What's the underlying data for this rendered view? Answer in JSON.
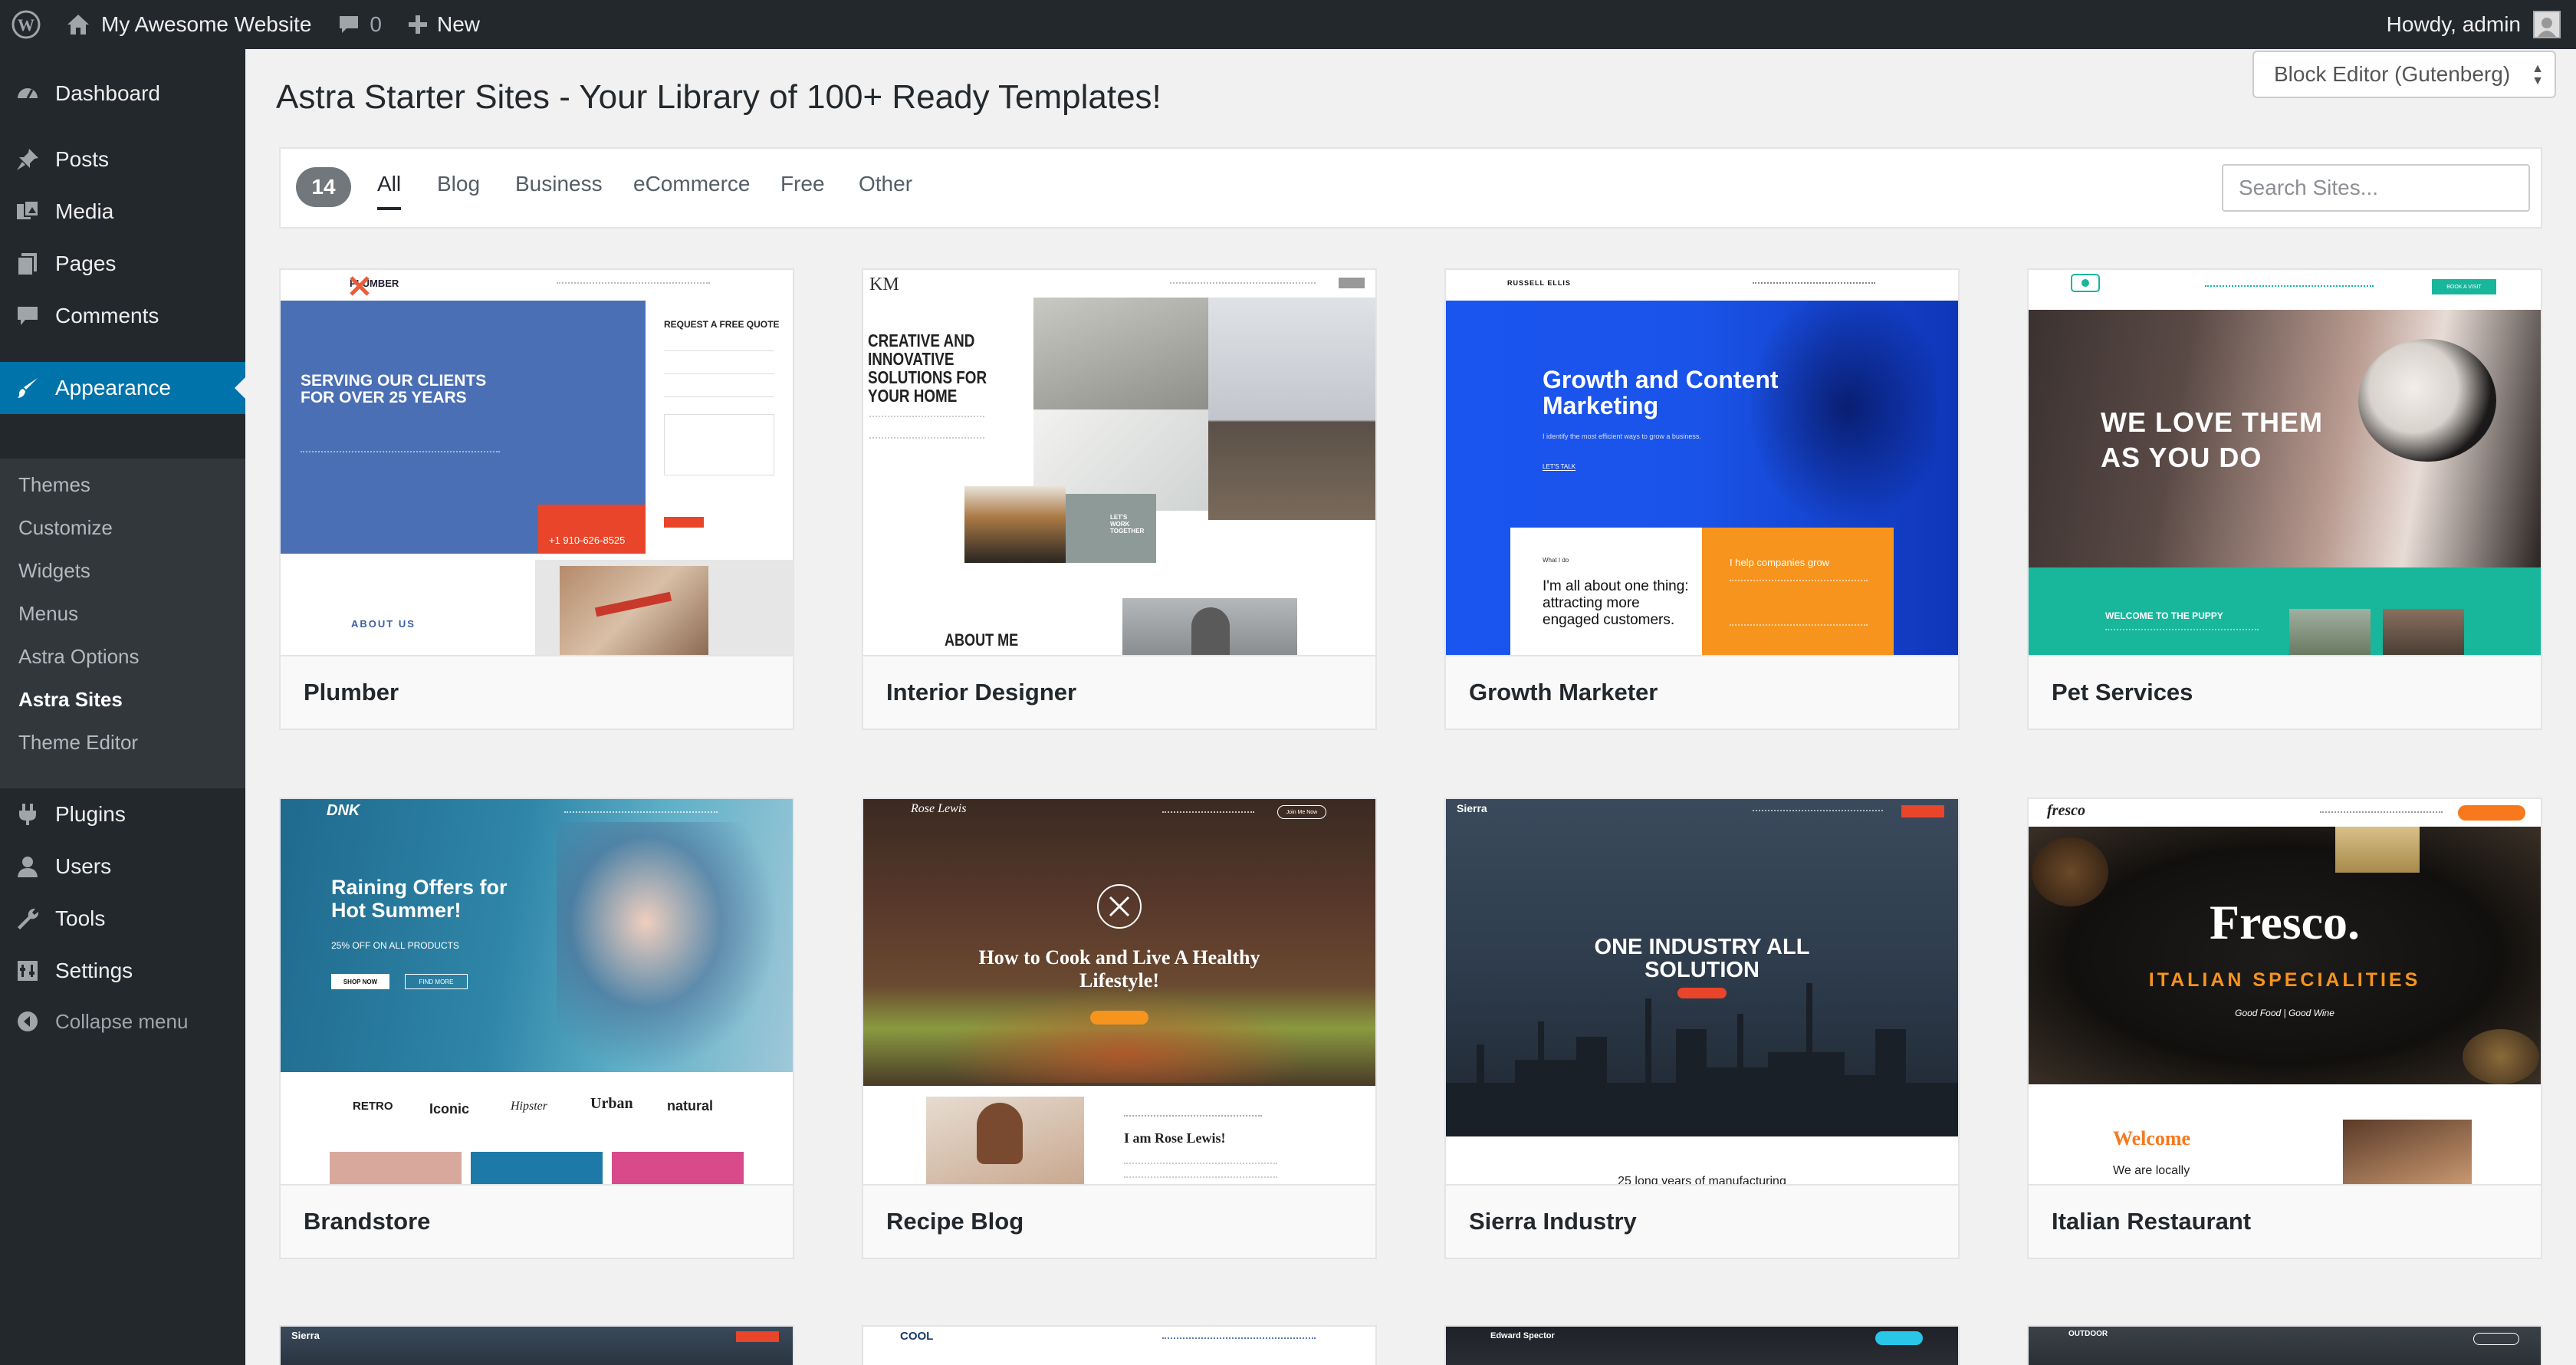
{
  "adminbar": {
    "site_name": "My Awesome Website",
    "comments_count": "0",
    "new_label": "New",
    "howdy": "Howdy, admin"
  },
  "sidebar": {
    "items": [
      {
        "label": "Dashboard",
        "icon": "dashboard-icon"
      },
      {
        "label": "Posts",
        "icon": "pin-icon"
      },
      {
        "label": "Media",
        "icon": "media-icon"
      },
      {
        "label": "Pages",
        "icon": "pages-icon"
      },
      {
        "label": "Comments",
        "icon": "comment-icon"
      },
      {
        "label": "Appearance",
        "icon": "paintbrush-icon",
        "active": true
      },
      {
        "label": "Plugins",
        "icon": "plug-icon"
      },
      {
        "label": "Users",
        "icon": "user-icon"
      },
      {
        "label": "Tools",
        "icon": "wrench-icon"
      },
      {
        "label": "Settings",
        "icon": "settings-icon"
      },
      {
        "label": "Collapse menu",
        "icon": "collapse-icon"
      }
    ],
    "submenu": [
      "Themes",
      "Customize",
      "Widgets",
      "Menus",
      "Astra Options",
      "Astra Sites",
      "Theme Editor"
    ],
    "current_submenu": "Astra Sites"
  },
  "main": {
    "title": "Astra Starter Sites - Your Library of 100+ Ready Templates!",
    "editor_select": "Block Editor (Gutenberg)",
    "filter": {
      "count": "14",
      "tabs": [
        "All",
        "Blog",
        "Business",
        "eCommerce",
        "Free",
        "Other"
      ],
      "active_tab": "All",
      "search_placeholder": "Search Sites..."
    },
    "cards": [
      {
        "name": "Plumber",
        "hero": "SERVING OUR CLIENTS FOR OVER 25 YEARS",
        "quote": "REQUEST A FREE QUOTE",
        "phone": "+1 910-626-8525",
        "about": "ABOUT US",
        "brand": "PLUMBER"
      },
      {
        "name": "Interior Designer",
        "hero": "CREATIVE AND INNOVATIVE SOLUTIONS FOR YOUR HOME",
        "about": "ABOUT ME",
        "brand": "KM",
        "cta": "LET'S WORK TOGETHER"
      },
      {
        "name": "Growth Marketer",
        "hero": "Growth and Content Marketing",
        "sub": "I identify the most efficient ways to grow a business.",
        "quote": "I'm all about one thing: attracting more engaged customers.",
        "help": "I help companies grow",
        "brand": "RUSSELL ELLIS",
        "cta": "LET'S TALK",
        "label": "What I do"
      },
      {
        "name": "Pet Services",
        "hero": "WE LOVE THEM AS YOU DO",
        "sub": "WELCOME TO THE PUPPY",
        "cta": "BOOK A VISIT"
      },
      {
        "name": "Brandstore",
        "hero": "Raining Offers for Hot Summer!",
        "sub": "25% OFF ON ALL PRODUCTS",
        "btn1": "SHOP NOW",
        "btn2": "FIND MORE",
        "brand": "DNK",
        "logos": [
          "RETRO",
          "Iconic",
          "Hipster",
          "Urban",
          "natural"
        ]
      },
      {
        "name": "Recipe Blog",
        "hero": "How to Cook and Live A Healthy Lifestyle!",
        "sub": "I am Rose Lewis!",
        "brand": "Rose Lewis",
        "cta": "Join Me Now"
      },
      {
        "name": "Sierra Industry",
        "hero": "ONE INDUSTRY ALL SOLUTION",
        "sub": "25 long years of manufacturing",
        "brand": "Sierra"
      },
      {
        "name": "Italian Restaurant",
        "hero": "Fresco.",
        "sub": "ITALIAN SPECIALITIES",
        "tagline": "Good Food | Good Wine",
        "welcome": "Welcome",
        "we_are": "We are locally",
        "brand": "fresco"
      }
    ],
    "peek_cards": [
      {
        "brand": "Sierra"
      },
      {
        "brand": "COOL"
      },
      {
        "brand": "Edward Spector"
      },
      {
        "brand": "OUTDOOR"
      }
    ]
  },
  "colors": {
    "adminbar": "#23282d",
    "sidebar": "#23282d",
    "active": "#0073aa",
    "plumber_blue": "#4a6fb5",
    "growth_blue": "#1a53e8",
    "pet_teal": "#18b69b",
    "orange": "#f7941d"
  }
}
